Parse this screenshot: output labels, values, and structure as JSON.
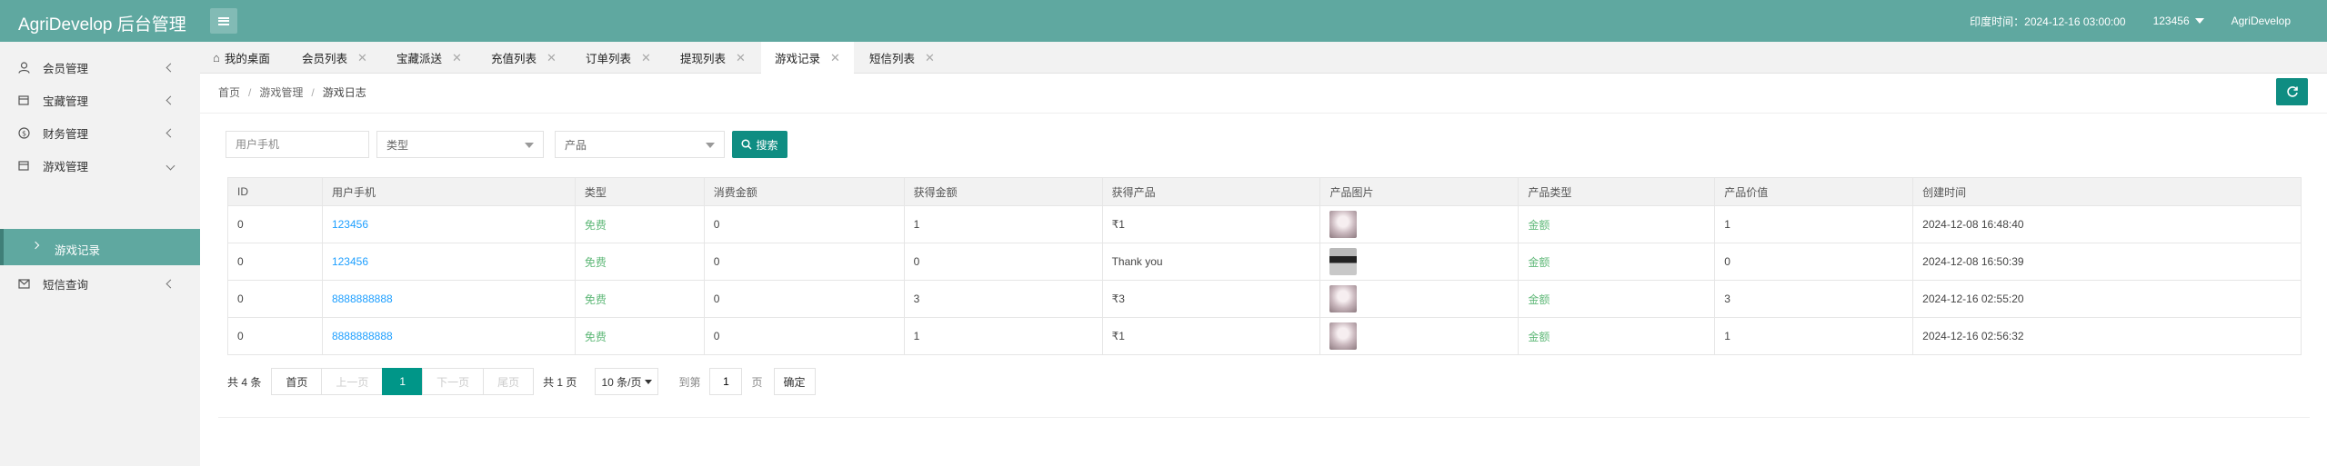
{
  "header": {
    "logo": "AgriDevelop 后台管理",
    "india_time": "印度时间：2024-12-16 03:00:00",
    "username": "123456",
    "brand": "AgriDevelop"
  },
  "sidebar": {
    "items": [
      {
        "label": "会员管理",
        "icon": "user-icon"
      },
      {
        "label": "宝藏管理",
        "icon": "calendar-icon"
      },
      {
        "label": "财务管理",
        "icon": "dollar-icon"
      },
      {
        "label": "游戏管理",
        "icon": "calendar-icon"
      },
      {
        "label": "短信查询",
        "icon": "mail-icon"
      }
    ],
    "active_sub": "游戏记录"
  },
  "tabs": [
    {
      "label": "我的桌面",
      "icon": "home-icon"
    },
    {
      "label": "会员列表"
    },
    {
      "label": "宝藏派送"
    },
    {
      "label": "充值列表"
    },
    {
      "label": "订单列表"
    },
    {
      "label": "提现列表"
    },
    {
      "label": "游戏记录"
    },
    {
      "label": "短信列表"
    }
  ],
  "breadcrumb": [
    "首页",
    "游戏管理",
    "游戏日志"
  ],
  "filters": {
    "phone_placeholder": "用户手机",
    "type_placeholder": "类型",
    "product_placeholder": "产品",
    "search_label": "搜索"
  },
  "table": {
    "columns": [
      "ID",
      "用户手机",
      "类型",
      "消费金额",
      "获得金额",
      "获得产品",
      "产品图片",
      "产品类型",
      "产品价值",
      "创建时间"
    ],
    "rows": [
      {
        "id": "0",
        "phone": "123456",
        "type": "免费",
        "spent": "0",
        "gained": "1",
        "product": "₹1",
        "image": "anime-avatar",
        "ptype": "金额",
        "value": "1",
        "created": "2024-12-08 16:48:40"
      },
      {
        "id": "0",
        "phone": "123456",
        "type": "免费",
        "spent": "0",
        "gained": "0",
        "product": "Thank you",
        "image": "sunglasses-avatar",
        "ptype": "金额",
        "value": "0",
        "created": "2024-12-08 16:50:39"
      },
      {
        "id": "0",
        "phone": "8888888888",
        "type": "免费",
        "spent": "0",
        "gained": "3",
        "product": "₹3",
        "image": "anime-avatar",
        "ptype": "金额",
        "value": "3",
        "created": "2024-12-16 02:55:20"
      },
      {
        "id": "0",
        "phone": "8888888888",
        "type": "免费",
        "spent": "0",
        "gained": "1",
        "product": "₹1",
        "image": "anime-avatar",
        "ptype": "金额",
        "value": "1",
        "created": "2024-12-16 02:56:32"
      }
    ]
  },
  "pager": {
    "total": "共 4 条",
    "first": "首页",
    "prev": "上一页",
    "current": "1",
    "next": "下一页",
    "last": "尾页",
    "pages": "共 1 页",
    "limit": "10 条/页",
    "goto_label": "到第",
    "goto_value": "1",
    "goto_suffix": "页",
    "confirm": "确定"
  },
  "colors": {
    "header": "#5fa8a0",
    "accent": "#0f8d82",
    "link": "#1e9fff",
    "green": "#5fb878"
  }
}
